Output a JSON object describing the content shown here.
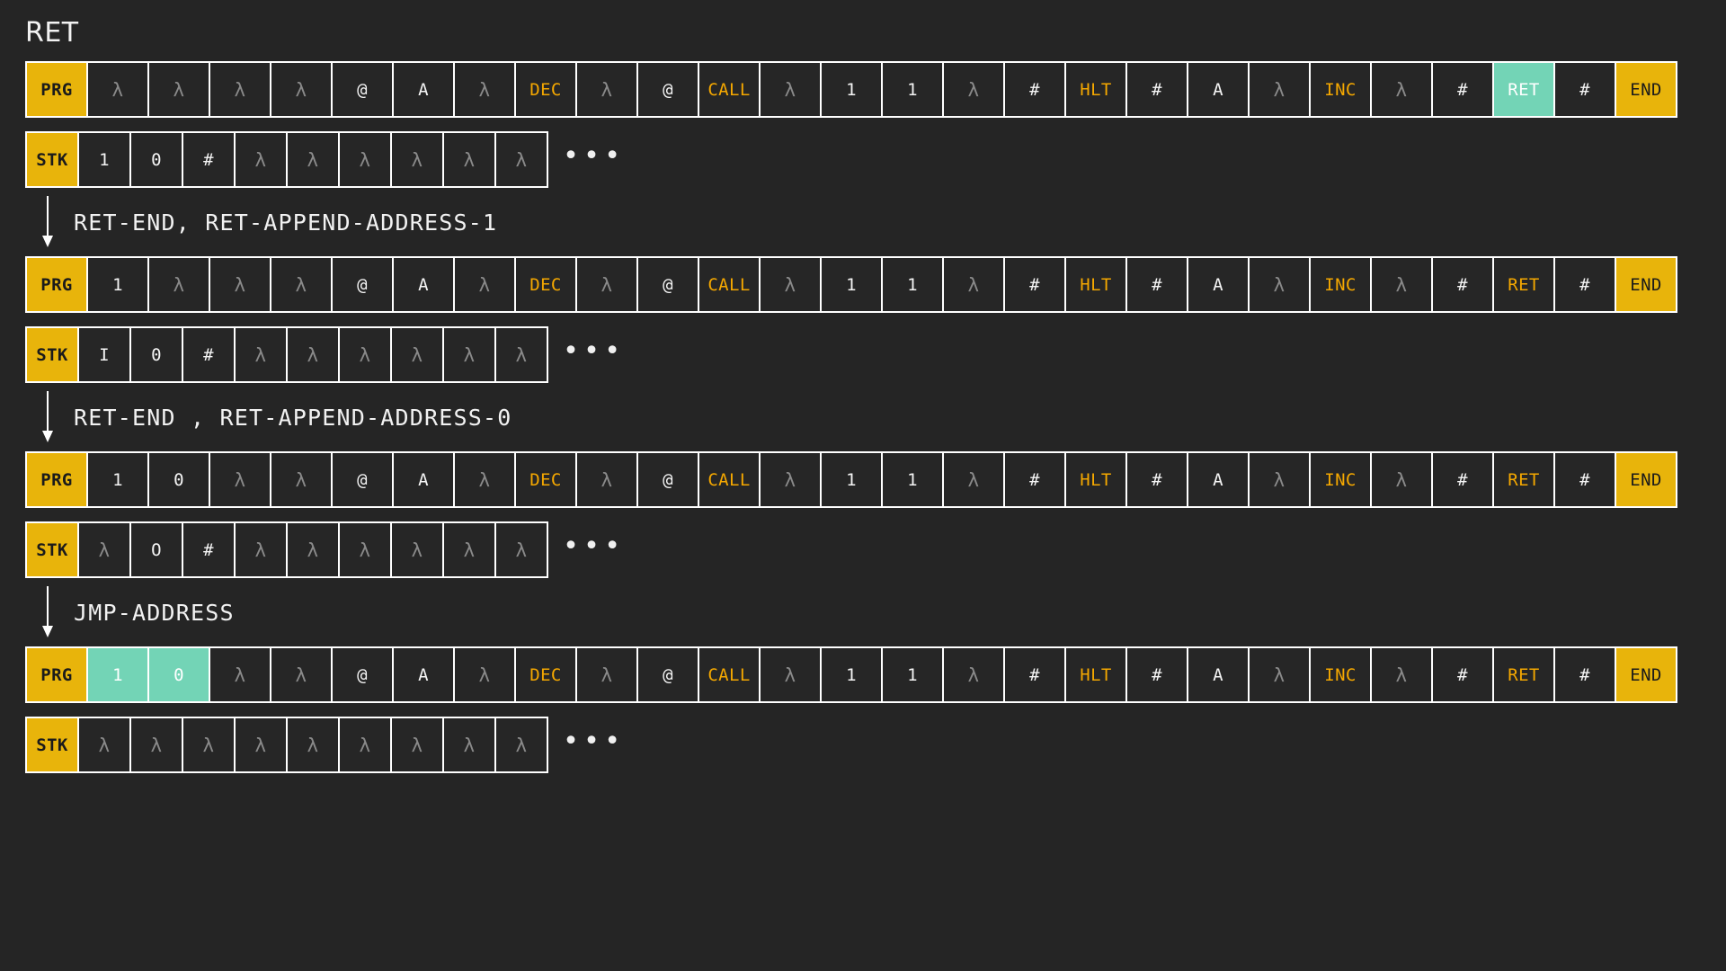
{
  "title": "RET",
  "theme": {
    "background": "#252525",
    "cell_background": "#262626",
    "label_yellow": "#e8b40b",
    "accent_orange": "#f5a800",
    "highlight_teal": "#73d4b6",
    "lambda_gray": "#8a8a8a",
    "border_white": "#ffffff",
    "text_white": "#f5f5f5"
  },
  "glyphs": {
    "lambda": "λ",
    "ellipsis": "•••"
  },
  "labels": {
    "prg": "PRG",
    "stk": "STK"
  },
  "sections": [
    {
      "prg": {
        "label": "PRG",
        "cells": [
          {
            "text": "λ",
            "style": "lam"
          },
          {
            "text": "λ",
            "style": "lam"
          },
          {
            "text": "λ",
            "style": "lam"
          },
          {
            "text": "λ",
            "style": "lam"
          },
          {
            "text": "@",
            "style": "plain"
          },
          {
            "text": "A",
            "style": "plain"
          },
          {
            "text": "λ",
            "style": "lam"
          },
          {
            "text": "DEC",
            "style": "accent"
          },
          {
            "text": "λ",
            "style": "lam"
          },
          {
            "text": "@",
            "style": "plain"
          },
          {
            "text": "CALL",
            "style": "accent"
          },
          {
            "text": "λ",
            "style": "lam"
          },
          {
            "text": "1",
            "style": "plain"
          },
          {
            "text": "1",
            "style": "plain"
          },
          {
            "text": "λ",
            "style": "lam"
          },
          {
            "text": "#",
            "style": "plain"
          },
          {
            "text": "HLT",
            "style": "accent"
          },
          {
            "text": "#",
            "style": "plain"
          },
          {
            "text": "A",
            "style": "plain"
          },
          {
            "text": "λ",
            "style": "lam"
          },
          {
            "text": "INC",
            "style": "accent"
          },
          {
            "text": "λ",
            "style": "lam"
          },
          {
            "text": "#",
            "style": "plain"
          },
          {
            "text": "RET",
            "style": "hl"
          },
          {
            "text": "#",
            "style": "plain"
          },
          {
            "text": "END",
            "style": "end"
          }
        ]
      },
      "stk": {
        "label": "STK",
        "cells": [
          {
            "text": "1",
            "style": "plain"
          },
          {
            "text": "0",
            "style": "plain"
          },
          {
            "text": "#",
            "style": "plain"
          },
          {
            "text": "λ",
            "style": "lam"
          },
          {
            "text": "λ",
            "style": "lam"
          },
          {
            "text": "λ",
            "style": "lam"
          },
          {
            "text": "λ",
            "style": "lam"
          },
          {
            "text": "λ",
            "style": "lam"
          },
          {
            "text": "λ",
            "style": "lam"
          }
        ],
        "ellipsis": "•••"
      }
    },
    {
      "prg": {
        "label": "PRG",
        "cells": [
          {
            "text": "1",
            "style": "plain"
          },
          {
            "text": "λ",
            "style": "lam"
          },
          {
            "text": "λ",
            "style": "lam"
          },
          {
            "text": "λ",
            "style": "lam"
          },
          {
            "text": "@",
            "style": "plain"
          },
          {
            "text": "A",
            "style": "plain"
          },
          {
            "text": "λ",
            "style": "lam"
          },
          {
            "text": "DEC",
            "style": "accent"
          },
          {
            "text": "λ",
            "style": "lam"
          },
          {
            "text": "@",
            "style": "plain"
          },
          {
            "text": "CALL",
            "style": "accent"
          },
          {
            "text": "λ",
            "style": "lam"
          },
          {
            "text": "1",
            "style": "plain"
          },
          {
            "text": "1",
            "style": "plain"
          },
          {
            "text": "λ",
            "style": "lam"
          },
          {
            "text": "#",
            "style": "plain"
          },
          {
            "text": "HLT",
            "style": "accent"
          },
          {
            "text": "#",
            "style": "plain"
          },
          {
            "text": "A",
            "style": "plain"
          },
          {
            "text": "λ",
            "style": "lam"
          },
          {
            "text": "INC",
            "style": "accent"
          },
          {
            "text": "λ",
            "style": "lam"
          },
          {
            "text": "#",
            "style": "plain"
          },
          {
            "text": "RET",
            "style": "accent"
          },
          {
            "text": "#",
            "style": "plain"
          },
          {
            "text": "END",
            "style": "end"
          }
        ]
      },
      "stk": {
        "label": "STK",
        "cells": [
          {
            "text": "I",
            "style": "plain"
          },
          {
            "text": "0",
            "style": "plain"
          },
          {
            "text": "#",
            "style": "plain"
          },
          {
            "text": "λ",
            "style": "lam"
          },
          {
            "text": "λ",
            "style": "lam"
          },
          {
            "text": "λ",
            "style": "lam"
          },
          {
            "text": "λ",
            "style": "lam"
          },
          {
            "text": "λ",
            "style": "lam"
          },
          {
            "text": "λ",
            "style": "lam"
          }
        ],
        "ellipsis": "•••"
      }
    },
    {
      "prg": {
        "label": "PRG",
        "cells": [
          {
            "text": "1",
            "style": "plain"
          },
          {
            "text": "0",
            "style": "plain"
          },
          {
            "text": "λ",
            "style": "lam"
          },
          {
            "text": "λ",
            "style": "lam"
          },
          {
            "text": "@",
            "style": "plain"
          },
          {
            "text": "A",
            "style": "plain"
          },
          {
            "text": "λ",
            "style": "lam"
          },
          {
            "text": "DEC",
            "style": "accent"
          },
          {
            "text": "λ",
            "style": "lam"
          },
          {
            "text": "@",
            "style": "plain"
          },
          {
            "text": "CALL",
            "style": "accent"
          },
          {
            "text": "λ",
            "style": "lam"
          },
          {
            "text": "1",
            "style": "plain"
          },
          {
            "text": "1",
            "style": "plain"
          },
          {
            "text": "λ",
            "style": "lam"
          },
          {
            "text": "#",
            "style": "plain"
          },
          {
            "text": "HLT",
            "style": "accent"
          },
          {
            "text": "#",
            "style": "plain"
          },
          {
            "text": "A",
            "style": "plain"
          },
          {
            "text": "λ",
            "style": "lam"
          },
          {
            "text": "INC",
            "style": "accent"
          },
          {
            "text": "λ",
            "style": "lam"
          },
          {
            "text": "#",
            "style": "plain"
          },
          {
            "text": "RET",
            "style": "accent"
          },
          {
            "text": "#",
            "style": "plain"
          },
          {
            "text": "END",
            "style": "end"
          }
        ]
      },
      "stk": {
        "label": "STK",
        "cells": [
          {
            "text": "λ",
            "style": "lam"
          },
          {
            "text": "O",
            "style": "plain"
          },
          {
            "text": "#",
            "style": "plain"
          },
          {
            "text": "λ",
            "style": "lam"
          },
          {
            "text": "λ",
            "style": "lam"
          },
          {
            "text": "λ",
            "style": "lam"
          },
          {
            "text": "λ",
            "style": "lam"
          },
          {
            "text": "λ",
            "style": "lam"
          },
          {
            "text": "λ",
            "style": "lam"
          }
        ],
        "ellipsis": "•••"
      }
    },
    {
      "prg": {
        "label": "PRG",
        "cells": [
          {
            "text": "1",
            "style": "hl"
          },
          {
            "text": "0",
            "style": "hl"
          },
          {
            "text": "λ",
            "style": "lam"
          },
          {
            "text": "λ",
            "style": "lam"
          },
          {
            "text": "@",
            "style": "plain"
          },
          {
            "text": "A",
            "style": "plain"
          },
          {
            "text": "λ",
            "style": "lam"
          },
          {
            "text": "DEC",
            "style": "accent"
          },
          {
            "text": "λ",
            "style": "lam"
          },
          {
            "text": "@",
            "style": "plain"
          },
          {
            "text": "CALL",
            "style": "accent"
          },
          {
            "text": "λ",
            "style": "lam"
          },
          {
            "text": "1",
            "style": "plain"
          },
          {
            "text": "1",
            "style": "plain"
          },
          {
            "text": "λ",
            "style": "lam"
          },
          {
            "text": "#",
            "style": "plain"
          },
          {
            "text": "HLT",
            "style": "accent"
          },
          {
            "text": "#",
            "style": "plain"
          },
          {
            "text": "A",
            "style": "plain"
          },
          {
            "text": "λ",
            "style": "lam"
          },
          {
            "text": "INC",
            "style": "accent"
          },
          {
            "text": "λ",
            "style": "lam"
          },
          {
            "text": "#",
            "style": "plain"
          },
          {
            "text": "RET",
            "style": "accent"
          },
          {
            "text": "#",
            "style": "plain"
          },
          {
            "text": "END",
            "style": "end"
          }
        ]
      },
      "stk": {
        "label": "STK",
        "cells": [
          {
            "text": "λ",
            "style": "lam"
          },
          {
            "text": "λ",
            "style": "lam"
          },
          {
            "text": "λ",
            "style": "lam"
          },
          {
            "text": "λ",
            "style": "lam"
          },
          {
            "text": "λ",
            "style": "lam"
          },
          {
            "text": "λ",
            "style": "lam"
          },
          {
            "text": "λ",
            "style": "lam"
          },
          {
            "text": "λ",
            "style": "lam"
          },
          {
            "text": "λ",
            "style": "lam"
          }
        ],
        "ellipsis": "•••"
      }
    }
  ],
  "transitions": [
    {
      "label": "RET-END, RET-APPEND-ADDRESS-1"
    },
    {
      "label": "RET-END , RET-APPEND-ADDRESS-0"
    },
    {
      "label": "JMP-ADDRESS"
    }
  ]
}
